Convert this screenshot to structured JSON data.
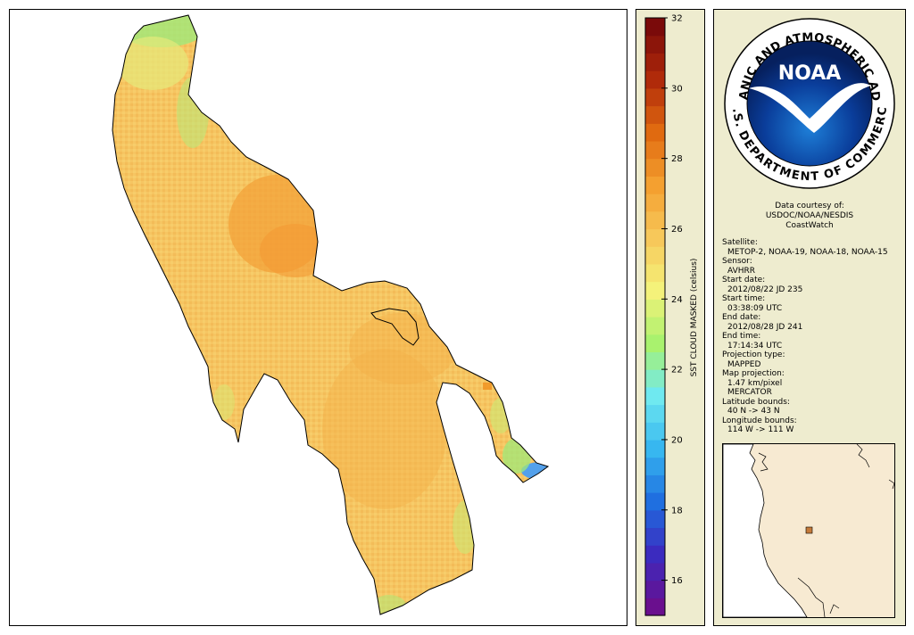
{
  "colorbar": {
    "title": "SST CLOUD MASKED (celsius)",
    "ticks": [
      "32",
      "30",
      "28",
      "26",
      "24",
      "22",
      "20",
      "18",
      "16"
    ],
    "tick_values": [
      32,
      30,
      28,
      26,
      24,
      22,
      20,
      18,
      16
    ],
    "min": 15,
    "max": 32,
    "colors": [
      "#6a0f8e",
      "#3b2bbf",
      "#1f6fe0",
      "#37b7f0",
      "#6fe9f0",
      "#a9f26e",
      "#f4f27a",
      "#f7c85a",
      "#f4a030",
      "#e06a10",
      "#b02a0a",
      "#7a0a0a"
    ]
  },
  "logo": {
    "top_text": "NATIONAL OCEANIC AND ATMOSPHERIC ADMINISTRATION",
    "bottom_text": "U.S. DEPARTMENT OF COMMERCE",
    "center_text": "NOAA"
  },
  "courtesy": {
    "line1": "Data courtesy of:",
    "line2": "USDOC/NOAA/NESDIS",
    "line3": "CoastWatch"
  },
  "metadata": [
    {
      "label": "Satellite:",
      "value": "METOP-2, NOAA-19, NOAA-18, NOAA-15"
    },
    {
      "label": "Sensor:",
      "value": "AVHRR"
    },
    {
      "label": "Start date:",
      "value": "2012/08/22 JD 235"
    },
    {
      "label": "Start time:",
      "value": "03:38:09 UTC"
    },
    {
      "label": "End date:",
      "value": "2012/08/28 JD 241"
    },
    {
      "label": "End time:",
      "value": "17:14:34 UTC"
    },
    {
      "label": "Projection type:",
      "value": "MAPPED"
    },
    {
      "label": "Map projection:",
      "value": "1.47 km/pixel",
      "value2": "MERCATOR"
    },
    {
      "label": "Latitude bounds:",
      "value": "40 N -> 43 N"
    },
    {
      "label": "Longitude bounds:",
      "value": "114 W -> 111 W"
    }
  ],
  "colors": {
    "panel_bg": "#eeeccf",
    "lake_base": "#f6c85e",
    "lake_warm": "#f3a83c",
    "lake_cool": "#c8e86a",
    "locator_land": "#f7ead2",
    "locator_marker": "#c47a3a"
  }
}
